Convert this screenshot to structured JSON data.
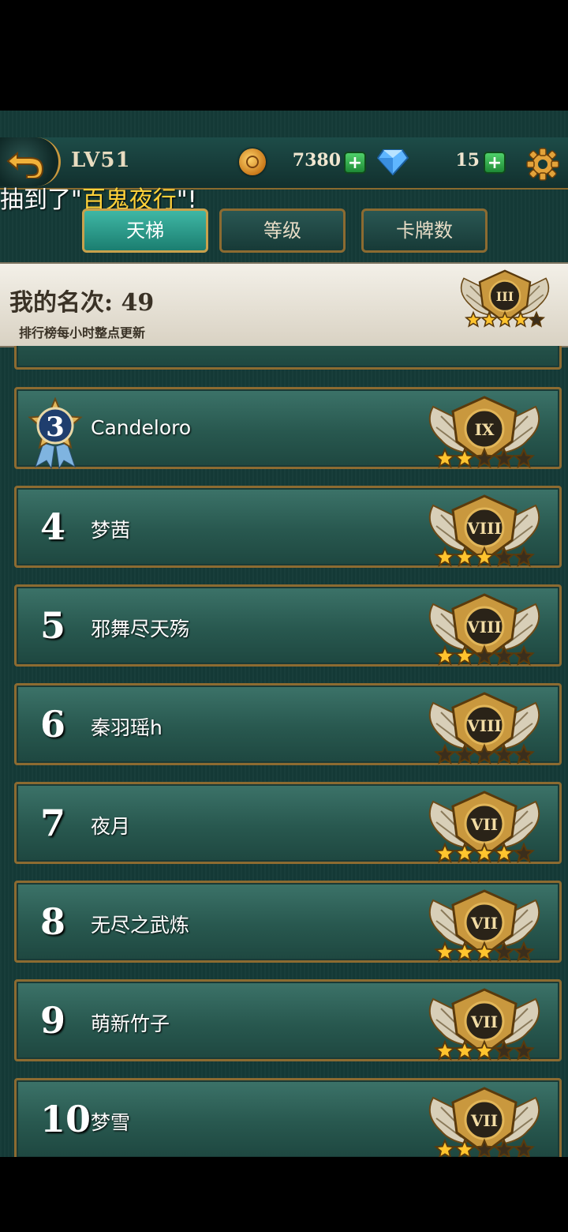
{
  "header": {
    "level": "LV51",
    "gold": "7380",
    "gems": "15"
  },
  "ticker": {
    "prefix": "抽到了\"",
    "highlight": "百鬼夜行",
    "suffix": "\"!"
  },
  "tabs": [
    {
      "label": "天梯",
      "active": true
    },
    {
      "label": "等级",
      "active": false
    },
    {
      "label": "卡牌数",
      "active": false
    }
  ],
  "my_rank": {
    "label": "我的名次: 49",
    "note": "排行榜每小时整点更新",
    "tier": "III",
    "stars": 4
  },
  "leaderboard": [
    {
      "rank": "3",
      "name": "Candeloro",
      "tier": "IX",
      "stars": 2
    },
    {
      "rank": "4",
      "name": "梦茜",
      "tier": "VIII",
      "stars": 3
    },
    {
      "rank": "5",
      "name": "邪舞尽天殇",
      "tier": "VIII",
      "stars": 2
    },
    {
      "rank": "6",
      "name": "秦羽瑶h",
      "tier": "VIII",
      "stars": 0
    },
    {
      "rank": "7",
      "name": "夜月",
      "tier": "VII",
      "stars": 4
    },
    {
      "rank": "8",
      "name": "无尽之武炼",
      "tier": "VII",
      "stars": 3
    },
    {
      "rank": "9",
      "name": "萌新竹子",
      "tier": "VII",
      "stars": 3
    },
    {
      "rank": "10",
      "name": "梦雪",
      "tier": "VII",
      "stars": 2
    }
  ],
  "colors": {
    "gold": "#c9983e",
    "panel": "#2c6359",
    "highlight": "#ffd23a"
  }
}
